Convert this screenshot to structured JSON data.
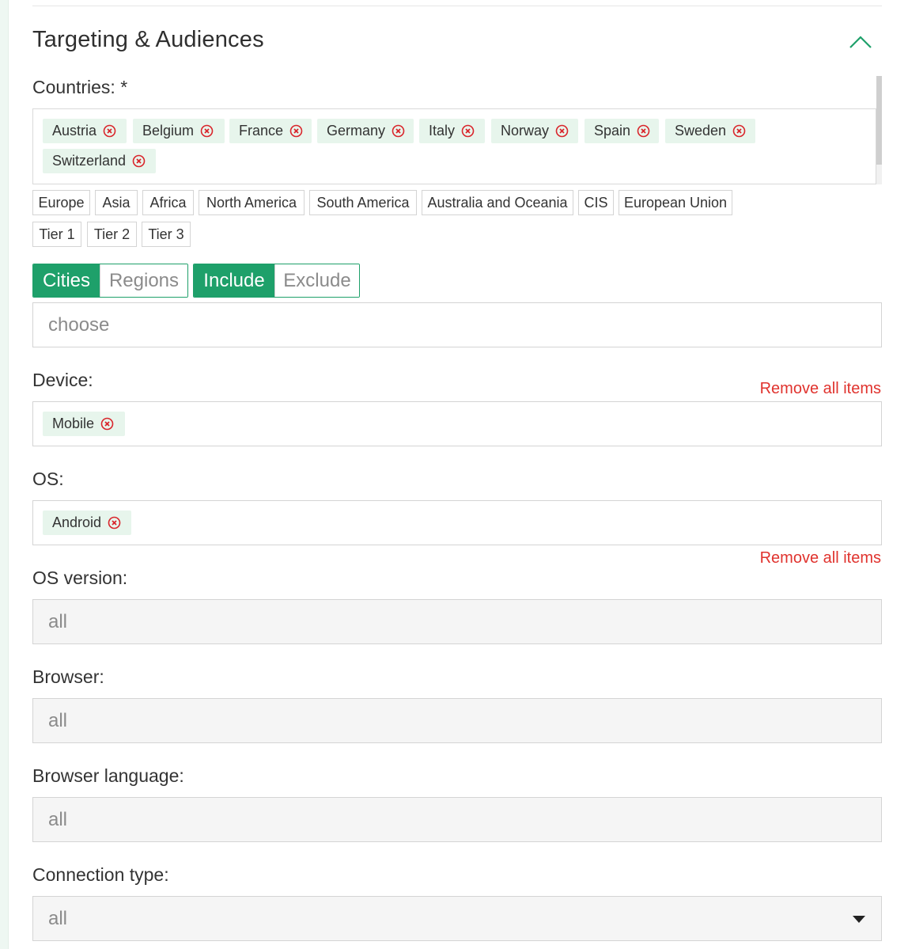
{
  "section": {
    "title": "Targeting & Audiences",
    "collapse_icon": "chevron-up-icon",
    "accent": "#1ea06a"
  },
  "countries": {
    "label": "Countries: *",
    "selected": [
      "Austria",
      "Belgium",
      "France",
      "Germany",
      "Italy",
      "Norway",
      "Spain",
      "Sweden",
      "Switzerland"
    ],
    "presets": [
      "Europe",
      "Asia",
      "Africa",
      "North America",
      "South America",
      "Australia and Oceania",
      "CIS",
      "European Union",
      "Tier 1",
      "Tier 2",
      "Tier 3"
    ]
  },
  "geo_toggle": {
    "cities": "Cities",
    "regions": "Regions",
    "include": "Include",
    "exclude": "Exclude",
    "active_geo": "Cities",
    "active_mode": "Include"
  },
  "geo_input": {
    "placeholder": "choose"
  },
  "device": {
    "label": "Device:",
    "remove_all": "Remove all items",
    "selected": [
      "Mobile"
    ]
  },
  "os": {
    "label": "OS:",
    "remove_all": "Remove all items",
    "selected": [
      "Android"
    ]
  },
  "os_version": {
    "label": "OS version:",
    "value": "all"
  },
  "browser": {
    "label": "Browser:",
    "value": "all"
  },
  "browser_language": {
    "label": "Browser language:",
    "value": "all"
  },
  "connection_type": {
    "label": "Connection type:",
    "value": "all",
    "icon": "caret-down-icon"
  },
  "colors": {
    "chip_bg": "#e7f5ec",
    "remove_red": "#e0332e",
    "chip_x_red": "#d9262c"
  }
}
